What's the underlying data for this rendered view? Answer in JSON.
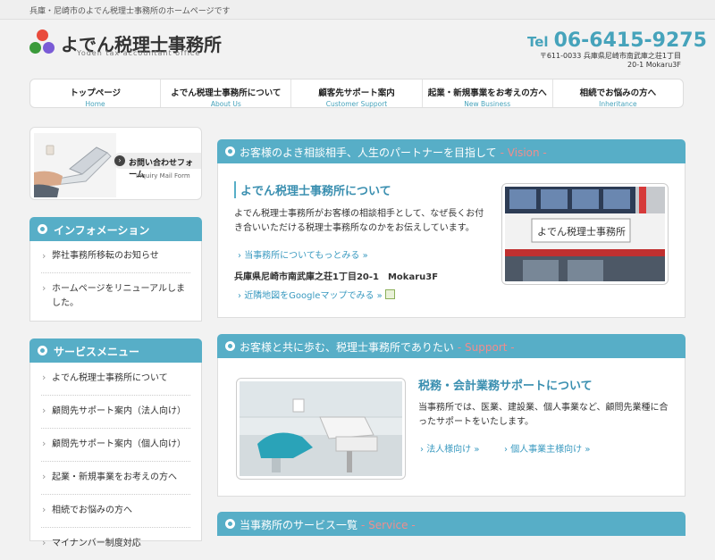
{
  "topbar": {
    "text": "兵庫・尼崎市のよでん税理士事務所のホームページです"
  },
  "header": {
    "brand": "よでん税理士事務所",
    "brand_sub": "Yoden tax accountant office",
    "tel_label": "Tel",
    "tel_number": "06-6415-9275",
    "address_line1": "〒611-0033 兵庫県尼崎市南武庫之荘1丁目",
    "address_line2": "20-1 Mokaru3F"
  },
  "nav": [
    {
      "jp": "トップページ",
      "en": "Home"
    },
    {
      "jp": "よでん税理士事務所について",
      "en": "About Us"
    },
    {
      "jp": "顧客先サポート案内",
      "en": "Customer Support"
    },
    {
      "jp": "起業・新規事業をお考えの方へ",
      "en": "New Business"
    },
    {
      "jp": "相続でお悩みの方へ",
      "en": "Inheritance"
    }
  ],
  "inquiry": {
    "title": "お問い合わせフォーム",
    "subtitle": "Inquiry Mail Form"
  },
  "info": {
    "heading": "インフォメーション",
    "items": [
      "弊社事務所移転のお知らせ",
      "ホームページをリニューアルしました。"
    ]
  },
  "service_menu": {
    "heading": "サービスメニュー",
    "items": [
      "よでん税理士事務所について",
      "顧問先サポート案内（法人向け）",
      "顧問先サポート案内（個人向け）",
      "起業・新規事業をお考えの方へ",
      "相続でお悩みの方へ",
      "マイナンバー制度対応"
    ]
  },
  "vision": {
    "heading": "お客様のよき相談相手、人生のパートナーを目指して",
    "heading_en": "- Vision -",
    "title": "よでん税理士事務所について",
    "body": "よでん税理士事務所がお客様の相談相手として、なぜ長くお付き合いいただける税理士事務所なのかをお伝えしています。",
    "more_link": "当事務所についてもっとみる »",
    "address": "兵庫県尼崎市南武庫之荘1丁目20-1　Mokaru3F",
    "map_link": "近隣地図をGoogleマップでみる »"
  },
  "support": {
    "heading": "お客様と共に歩む、税理士事務所でありたい",
    "heading_en": "- Support -",
    "title": "税務・会計業務サポートについて",
    "body": "当事務所では、医業、建設業、個人事業など、顧問先業種に合ったサポートをいたします。",
    "link1": "法人様向け »",
    "link2": "個人事業主様向け »"
  },
  "service": {
    "heading": "当事務所のサービス一覧",
    "heading_en": "- Service -"
  },
  "colors": {
    "accent": "#57aec7",
    "link": "#3a9ac0",
    "heading_en": "#f08d8d"
  }
}
